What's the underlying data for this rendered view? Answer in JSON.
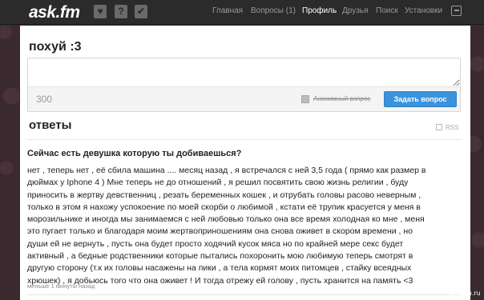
{
  "header": {
    "logo": "ask.fm",
    "icons": [
      "heart-icon",
      "question-icon",
      "check-icon"
    ],
    "nav": [
      {
        "label": "Главная",
        "active": false
      },
      {
        "label": "Вопросы (1)",
        "active": false
      },
      {
        "label": "Профиль",
        "active": true
      },
      {
        "label": "Друзья",
        "active": false
      },
      {
        "label": "Поиск",
        "active": false
      },
      {
        "label": "Установки",
        "active": false
      }
    ],
    "logout_icon": "logout-icon"
  },
  "profile": {
    "name": "похуй :3"
  },
  "ask_form": {
    "question_value": "",
    "char_count": "300",
    "anonymous_label": "Анонимный вопрос",
    "submit_label": "Задать вопрос"
  },
  "answers": {
    "title": "ответы",
    "rss_label": "RSS",
    "items": [
      {
        "question": "Сейчас есть девушка которую ты добиваешься?",
        "answer_lines": [
          "нет , теперь нет , её сбила машина .... месяц назад , я встречался с ней 3,5 года ( прямо как размер в",
          "дюймах у Iphone 4 ) Мне теперь не до отношений , я решил посвятить свою жизнь религии , буду",
          "приносить в жертву девственниц , резать беременных кошек , и отрубать головы расово неверным ,",
          "только в этом я нахожу успокоение по моей скорби о любимой , кстати её трупик красуется у меня в",
          "морозильнике и иногда мы занимаемся с ней любовью только она все время холодная ко мне , меня",
          "это пугает только и благодаря моим жертвоприношениям она снова оживет в скором времени , но",
          "души ей не вернуть , пусть она будет просто ходячий кусок мяса но по крайней мере секс будет",
          "активный , а бедные родственники которые пытались похоронить мою любимую теперь смотрят в",
          "другую сторону (т.к их головы насажены на пики , а тела кормят моих питомцев , стайку всеядных",
          "хрюшек) , я добьюсь того что она оживет ! И тогда отрежу ей голову , пусть хранится на память <3"
        ],
        "timestamp": "меньше 1 минуты назад"
      }
    ]
  },
  "watermark": "pikabu.ru",
  "colors": {
    "topbar": "#2b2b2b",
    "button": "#3a93dc",
    "background": "#3a2a30"
  }
}
